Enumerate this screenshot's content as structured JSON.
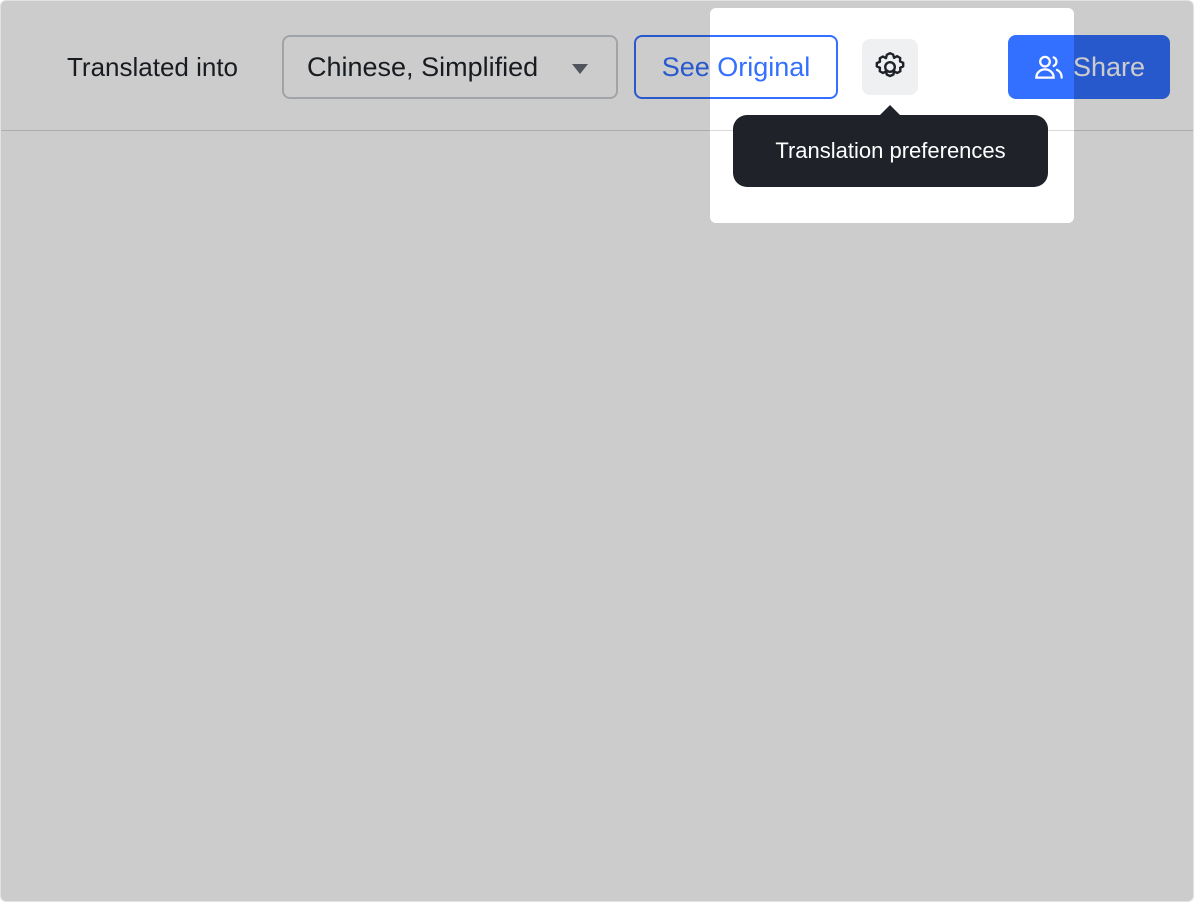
{
  "toolbar": {
    "translated_label": "Translated into",
    "language_select": {
      "value": "Chinese, Simplified",
      "icon": "caret-down-icon"
    },
    "see_original_label": "See Original",
    "settings_icon": "gear-icon",
    "share": {
      "label": "Share",
      "icon": "users-icon"
    }
  },
  "tooltip": {
    "text": "Translation preferences"
  },
  "colors": {
    "accent": "#3370ff",
    "tooltip_bg": "#1f2329",
    "overlay": "rgba(0,0,0,0.2)",
    "text": "#1f2329"
  }
}
